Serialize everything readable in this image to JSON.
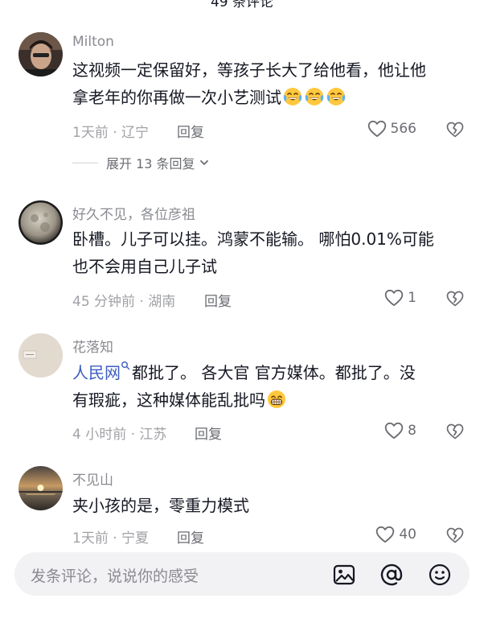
{
  "header": {
    "title": "49 条评论"
  },
  "comments": [
    {
      "username": "Milton",
      "text_line1": "这视频一定保留好，等孩子长大了给他看，他让他",
      "text_line2": "拿老年的你再做一次小艺测试",
      "meta": "1天前 · 辽宁",
      "reply": "回复",
      "likes": "566",
      "expand": "展开 13 条回复"
    },
    {
      "username": "好久不见，各位彦祖",
      "text_line1": "卧槽。儿子可以挂。鸿蒙不能输。 哪怕0.01%可能",
      "text_line2": "也不会用自己儿子试",
      "meta": "45 分钟前 · 湖南",
      "reply": "回复",
      "likes": "1"
    },
    {
      "username": "花落知",
      "mention": "人民网",
      "text_line1": "都批了。 各大官 官方媒体。都批了。没",
      "text_line2": "有瑕疵，这种媒体能乱批吗",
      "meta": "4 小时前 · 江苏",
      "reply": "回复",
      "likes": "8"
    },
    {
      "username": "不见山",
      "text_line1": "夹小孩的是，零重力模式",
      "meta": "1天前 · 宁夏",
      "reply": "回复",
      "likes": "40"
    }
  ],
  "input": {
    "placeholder": "发条评论，说说你的感受"
  },
  "colors": {
    "text": "#161823",
    "secondary": "#8a8b91",
    "mention": "#3b5cc2",
    "bar": "#f2f2f4"
  },
  "icons": [
    "heart-icon",
    "broken-heart-icon",
    "laugh-cry-emoji",
    "grin-emoji",
    "image-icon",
    "at-icon",
    "smile-icon",
    "search-icon",
    "chevron-down-icon"
  ]
}
